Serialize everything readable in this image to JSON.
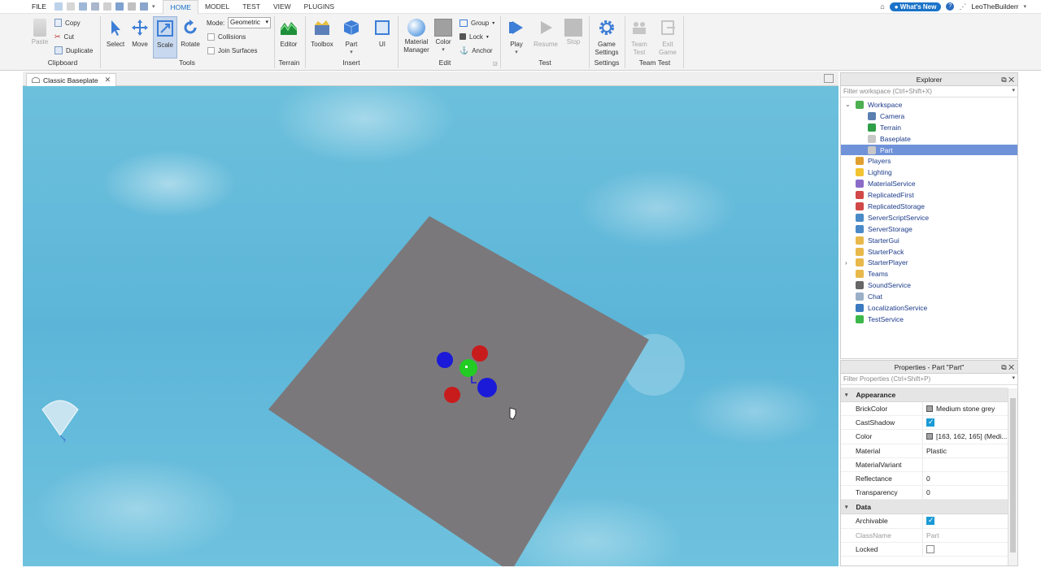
{
  "menubar": {
    "file": "FILE",
    "tabs": [
      "HOME",
      "MODEL",
      "TEST",
      "VIEW",
      "PLUGINS"
    ],
    "active_tab": "HOME",
    "whats_new": "What's New",
    "username": "LeoTheBuilderr"
  },
  "ribbon": {
    "clipboard": {
      "paste": "Paste",
      "copy": "Copy",
      "cut": "Cut",
      "duplicate": "Duplicate",
      "group": "Clipboard"
    },
    "tools": {
      "select": "Select",
      "move": "Move",
      "scale": "Scale",
      "rotate": "Rotate",
      "mode_label": "Mode:",
      "mode_value": "Geometric",
      "collisions": "Collisions",
      "join_surfaces": "Join Surfaces",
      "group": "Tools"
    },
    "terrain": {
      "editor": "Editor",
      "group": "Terrain"
    },
    "insert": {
      "toolbox": "Toolbox",
      "part": "Part",
      "ui": "UI",
      "group": "Insert"
    },
    "edit": {
      "material_manager_1": "Material",
      "material_manager_2": "Manager",
      "color": "Color",
      "group_btn": "Group",
      "lock": "Lock",
      "anchor": "Anchor",
      "group": "Edit"
    },
    "test": {
      "play": "Play",
      "resume": "Resume",
      "stop": "Stop",
      "group": "Test"
    },
    "settings": {
      "game_settings_1": "Game",
      "game_settings_2": "Settings",
      "group": "Settings"
    },
    "team_test": {
      "team_test_1": "Team",
      "team_test_2": "Test",
      "exit_game_1": "Exit",
      "exit_game_2": "Game",
      "group": "Team Test"
    }
  },
  "document": {
    "tab_title": "Classic Baseplate"
  },
  "explorer": {
    "title": "Explorer",
    "filter_placeholder": "Filter workspace (Ctrl+Shift+X)",
    "items": [
      {
        "label": "Workspace",
        "depth": 0,
        "expanded": true,
        "color": "#4caf50"
      },
      {
        "label": "Camera",
        "depth": 1,
        "color": "#5a7fb0"
      },
      {
        "label": "Terrain",
        "depth": 1,
        "color": "#2e9e48"
      },
      {
        "label": "Baseplate",
        "depth": 1,
        "color": "#c8c8c8"
      },
      {
        "label": "Part",
        "depth": 1,
        "selected": true,
        "color": "#c8c8c8"
      },
      {
        "label": "Players",
        "depth": 0,
        "color": "#e0a030"
      },
      {
        "label": "Lighting",
        "depth": 0,
        "color": "#f2c230"
      },
      {
        "label": "MaterialService",
        "depth": 0,
        "color": "#8a6cc8"
      },
      {
        "label": "ReplicatedFirst",
        "depth": 0,
        "color": "#d04848"
      },
      {
        "label": "ReplicatedStorage",
        "depth": 0,
        "color": "#d04848"
      },
      {
        "label": "ServerScriptService",
        "depth": 0,
        "color": "#4a8ac8"
      },
      {
        "label": "ServerStorage",
        "depth": 0,
        "color": "#4a8ac8"
      },
      {
        "label": "StarterGui",
        "depth": 0,
        "color": "#e8b84a"
      },
      {
        "label": "StarterPack",
        "depth": 0,
        "color": "#e8b84a"
      },
      {
        "label": "StarterPlayer",
        "depth": 0,
        "collapsed": true,
        "color": "#e8b84a"
      },
      {
        "label": "Teams",
        "depth": 0,
        "color": "#e8b84a"
      },
      {
        "label": "SoundService",
        "depth": 0,
        "color": "#666666"
      },
      {
        "label": "Chat",
        "depth": 0,
        "color": "#9ab0c8"
      },
      {
        "label": "LocalizationService",
        "depth": 0,
        "color": "#3a7ac0"
      },
      {
        "label": "TestService",
        "depth": 0,
        "color": "#3cb84a"
      }
    ]
  },
  "properties": {
    "title": "Properties - Part \"Part\"",
    "filter_placeholder": "Filter Properties (Ctrl+Shift+P)",
    "sections": [
      {
        "name": "Appearance",
        "rows": [
          {
            "name": "BrickColor",
            "value": "Medium stone grey",
            "swatch": true
          },
          {
            "name": "CastShadow",
            "checkbox": true,
            "checked": true
          },
          {
            "name": "Color",
            "value": "[163, 162, 165] (Medi...",
            "swatch": true
          },
          {
            "name": "Material",
            "value": "Plastic"
          },
          {
            "name": "MaterialVariant",
            "value": ""
          },
          {
            "name": "Reflectance",
            "value": "0"
          },
          {
            "name": "Transparency",
            "value": "0"
          }
        ]
      },
      {
        "name": "Data",
        "rows": [
          {
            "name": "Archivable",
            "checkbox": true,
            "checked": true
          },
          {
            "name": "ClassName",
            "value": "Part",
            "dim": true
          },
          {
            "name": "Locked",
            "checkbox": true,
            "checked": false
          }
        ]
      }
    ]
  },
  "colors": {
    "accent": "#1a73c9",
    "selection": "#6f92d8",
    "part_grey": "#7b787b",
    "handle_red": "#c81c1c",
    "handle_blue": "#1a1ad8",
    "handle_green": "#22cc22"
  }
}
